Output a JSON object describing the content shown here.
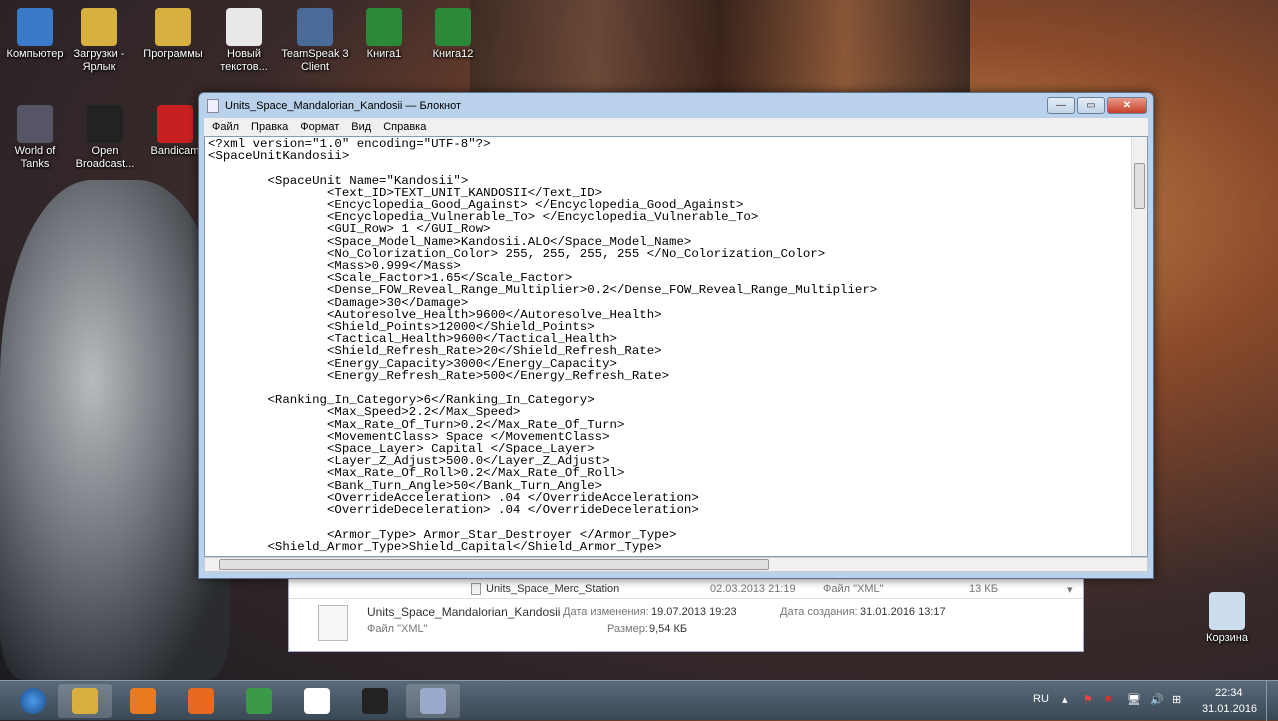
{
  "desktop": {
    "icons": [
      {
        "label": "Компьютер",
        "color": "#3a7ac8"
      },
      {
        "label": "Загрузки - Ярлык",
        "color": "#d8b040"
      },
      {
        "label": "Программы",
        "color": "#d8b040"
      },
      {
        "label": "Новый текстов...",
        "color": "#e8e8e8"
      },
      {
        "label": "TeamSpeak 3 Client",
        "color": "#4a6a9a"
      },
      {
        "label": "Книга1",
        "color": "#2a8a3a"
      },
      {
        "label": "Книга12",
        "color": "#2a8a3a"
      },
      {
        "label": "World of Tanks",
        "color": "#556"
      },
      {
        "label": "Open Broadcast...",
        "color": "#222"
      },
      {
        "label": "Bandicam",
        "color": "#c82020"
      },
      {
        "label": "Корзина",
        "color": "#cde"
      }
    ]
  },
  "notepad": {
    "title": "Units_Space_Mandalorian_Kandosii — Блокнот",
    "menu": [
      "Файл",
      "Правка",
      "Формат",
      "Вид",
      "Справка"
    ],
    "content": "<?xml version=\"1.0\" encoding=\"UTF-8\"?>\n<SpaceUnitKandosii>\n\n\t<SpaceUnit Name=\"Kandosii\">\n\t\t<Text_ID>TEXT_UNIT_KANDOSII</Text_ID>\n\t\t<Encyclopedia_Good_Against> </Encyclopedia_Good_Against>\n\t\t<Encyclopedia_Vulnerable_To> </Encyclopedia_Vulnerable_To>\n\t\t<GUI_Row> 1 </GUI_Row>\n\t\t<Space_Model_Name>Kandosii.ALO</Space_Model_Name>\n\t\t<No_Colorization_Color> 255, 255, 255, 255 </No_Colorization_Color>\n\t\t<Mass>0.999</Mass>\n\t\t<Scale_Factor>1.65</Scale_Factor>\n\t\t<Dense_FOW_Reveal_Range_Multiplier>0.2</Dense_FOW_Reveal_Range_Multiplier>\n\t\t<Damage>30</Damage>\n\t\t<Autoresolve_Health>9600</Autoresolve_Health>\n\t\t<Shield_Points>12000</Shield_Points>\n\t\t<Tactical_Health>9600</Tactical_Health>\n\t\t<Shield_Refresh_Rate>20</Shield_Refresh_Rate>\n\t\t<Energy_Capacity>3000</Energy_Capacity>\n\t\t<Energy_Refresh_Rate>500</Energy_Refresh_Rate>\n\n\t<Ranking_In_Category>6</Ranking_In_Category>\n\t\t<Max_Speed>2.2</Max_Speed>\n\t\t<Max_Rate_Of_Turn>0.2</Max_Rate_Of_Turn>\n\t\t<MovementClass> Space </MovementClass>\n\t\t<Space_Layer> Capital </Space_Layer>\n\t\t<Layer_Z_Adjust>500.0</Layer_Z_Adjust>\n\t\t<Max_Rate_Of_Roll>0.2</Max_Rate_Of_Roll>\n\t\t<Bank_Turn_Angle>50</Bank_Turn_Angle>\n\t\t<OverrideAcceleration> .04 </OverrideAcceleration>\n\t\t<OverrideDeceleration> .04 </OverrideDeceleration>\n\n\t\t<Armor_Type> Armor_Star_Destroyer </Armor_Type>\n\t<Shield_Armor_Type>Shield_Capital</Shield_Armor_Type>"
  },
  "explorer": {
    "row": {
      "name": "Units_Space_Merc_Station",
      "date": "02.03.2013 21:19",
      "type": "Файл \"XML\"",
      "size": "13 КБ"
    },
    "details": {
      "name": "Units_Space_Mandalorian_Kandosii",
      "modified_label": "Дата изменения:",
      "modified": "19.07.2013 19:23",
      "created_label": "Дата создания:",
      "created": "31.01.2016 13:17",
      "type": "Файл \"XML\"",
      "size_label": "Размер:",
      "size": "9,54 КБ"
    }
  },
  "taskbar": {
    "apps": [
      "start",
      "explorer",
      "media-player",
      "firefox",
      "chrome",
      "yandex",
      "obs",
      "notepad"
    ],
    "lang": "RU",
    "time": "22:34",
    "date": "31.01.2016"
  }
}
